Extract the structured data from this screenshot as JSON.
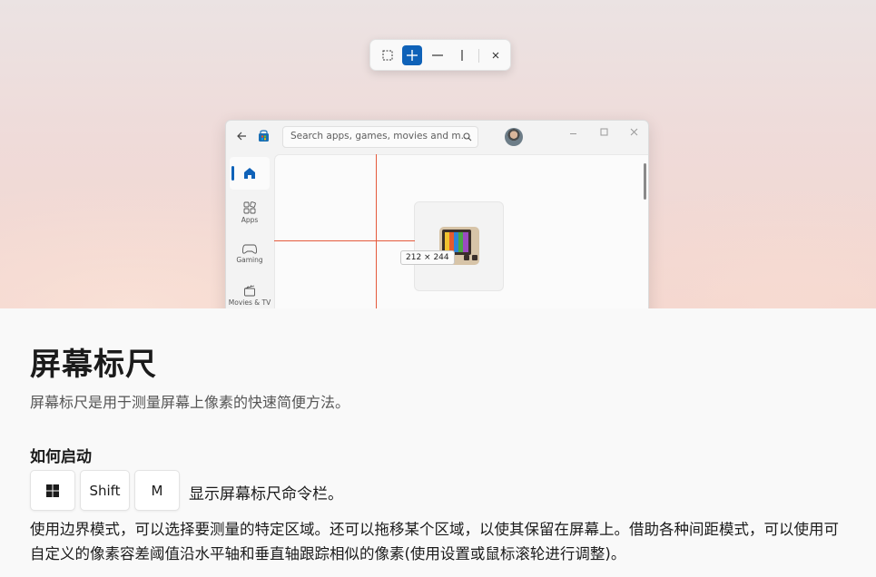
{
  "hero": {
    "toolbar": {
      "items": [
        {
          "name": "bounds-mode",
          "glyph": "⬚"
        },
        {
          "name": "spacing-mode",
          "glyph": "+"
        },
        {
          "name": "horizontal-spacing",
          "glyph": "—"
        },
        {
          "name": "vertical-spacing",
          "glyph": "|"
        },
        {
          "name": "close",
          "glyph": "×"
        }
      ]
    },
    "store": {
      "search_placeholder": "Search apps, games, movies and m...",
      "nav": [
        {
          "label": "Apps"
        },
        {
          "label": "Gaming"
        },
        {
          "label": "Movies & TV"
        }
      ]
    },
    "measurement": "212 × 244"
  },
  "page": {
    "title": "屏幕标尺",
    "subtitle": "屏幕标尺是用于测量屏幕上像素的快速简便方法。",
    "how_to_start": "如何启动",
    "keys": [
      "Shift",
      "M"
    ],
    "keys_description": "显示屏幕标尺命令栏。",
    "description": "使用边界模式，可以选择要测量的特定区域。还可以拖移某个区域，以使其保留在屏幕上。借助各种间距模式，可以使用可自定义的像素容差阈值沿水平轴和垂直轴跟踪相似的像素(使用设置或鼠标滚轮进行调整)。"
  },
  "colors": {
    "accent": "#0f62b8",
    "measure_line": "#e55a3c"
  }
}
